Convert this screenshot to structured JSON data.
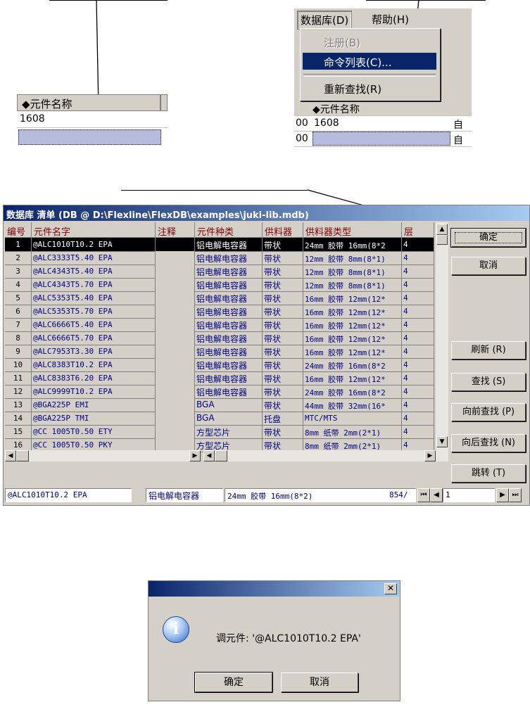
{
  "panel_a": {
    "column_header": "◆元件名称",
    "cell_value": "1608"
  },
  "panel_b": {
    "menu": [
      "数据库(D)",
      "帮助(H)"
    ],
    "dropdown": [
      {
        "label": "注册(B)",
        "disabled": true
      },
      {
        "label": "命令列表(C)...",
        "highlighted": true
      },
      {
        "label": "重新查找(R)"
      }
    ],
    "grid_header": "◆元件名称",
    "grid_row": "1608",
    "grid_row_prefix": "00",
    "grid_col3": "自"
  },
  "main_window": {
    "title": "数据库 清单 (DB @ D:\\Flexline\\FlexDB\\examples\\juki-lib.mdb)",
    "columns": [
      "编号",
      "元件名字",
      "注释",
      "元件种类",
      "供料器",
      "供料器类型",
      "层"
    ],
    "rows": [
      [
        "1",
        "@ALC1010T10.2   EPA",
        "",
        "铝电解电容器",
        "带状",
        "24mm 胶带 16mm(8*2",
        "4"
      ],
      [
        "2",
        "@ALC3333T5.40   EPA",
        "",
        "铝电解电容器",
        "带状",
        "12mm 胶带 8mm(8*1)",
        "4"
      ],
      [
        "3",
        "@ALC4343T5.40   EPA",
        "",
        "铝电解电容器",
        "带状",
        "12mm 胶带 8mm(8*1)",
        "4"
      ],
      [
        "4",
        "@ALC4343T5.70   EPA",
        "",
        "铝电解电容器",
        "带状",
        "12mm 胶带 8mm(8*1)",
        "4"
      ],
      [
        "5",
        "@ALC5353T5.40   EPA",
        "",
        "铝电解电容器",
        "带状",
        "16mm 胶带 12mm(12*",
        "4"
      ],
      [
        "6",
        "@ALC5353T5.70   EPA",
        "",
        "铝电解电容器",
        "带状",
        "16mm 胶带 12mm(12*",
        "4"
      ],
      [
        "7",
        "@ALC6666T5.40   EPA",
        "",
        "铝电解电容器",
        "带状",
        "16mm 胶带 12mm(12*",
        "4"
      ],
      [
        "8",
        "@ALC6666T5.70   EPA",
        "",
        "铝电解电容器",
        "带状",
        "16mm 胶带 12mm(12*",
        "4"
      ],
      [
        "9",
        "@ALC7953T3.30   EPA",
        "",
        "铝电解电容器",
        "带状",
        "16mm 胶带 12mm(12*",
        "4"
      ],
      [
        "10",
        "@ALC8383T10.2   EPA",
        "",
        "铝电解电容器",
        "带状",
        "24mm 胶带 16mm(8*2",
        "4"
      ],
      [
        "11",
        "@ALC8383T6.20   EPA",
        "",
        "铝电解电容器",
        "带状",
        "16mm 胶带 12mm(12*",
        "4"
      ],
      [
        "12",
        "@ALC9999T10.2   EPA",
        "",
        "铝电解电容器",
        "带状",
        "24mm 胶带 16mm(8*2",
        "4"
      ],
      [
        "13",
        "@BGA225P        EMI",
        "",
        "BGA",
        "带状",
        "44mm 胶带 32mm(16*",
        "4"
      ],
      [
        "14",
        "@BGA225P        TMI",
        "",
        "BGA",
        "托盘",
        "MTC/MTS",
        "4"
      ],
      [
        "15",
        "@CC 1005T0.50   ETY",
        "",
        "方型芯片",
        "带状",
        "8mm 纸带 2mm(2*1)",
        "4"
      ],
      [
        "16",
        "@CC 1005T0.50   PKY",
        "",
        "方型芯片",
        "带状",
        "8mm 纸带 2mm(2*1)",
        "4"
      ]
    ],
    "buttons": {
      "ok": "确定",
      "cancel": "取消",
      "refresh": "刷新 (R)",
      "find": "查找 (S)",
      "find_prev": "向前查找 (P)",
      "find_next": "向后查找 (N)",
      "jump": "跳转 (T)"
    },
    "status": {
      "part_name": "@ALC1010T10.2    EPA",
      "kind": "铝电解电容器",
      "feeder_type": "24mm 胶带 16mm(8*2)",
      "count": "854/",
      "record": "1"
    }
  },
  "message_box": {
    "text": "调元件:  '@ALC1010T10.2   EPA'",
    "ok": "确定",
    "cancel": "取消",
    "close_glyph": "✕"
  }
}
